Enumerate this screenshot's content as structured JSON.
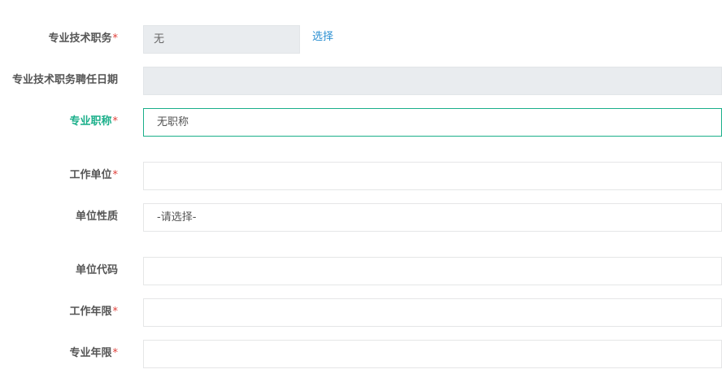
{
  "form": {
    "fields": [
      {
        "label": "专业技术职务",
        "required": true,
        "value": "无",
        "action": "选择"
      },
      {
        "label": "专业技术职务聘任日期",
        "required": false,
        "value": ""
      },
      {
        "label": "专业职称",
        "required": true,
        "value": "无职称"
      },
      {
        "label": "工作单位",
        "required": true,
        "value": ""
      },
      {
        "label": "单位性质",
        "required": false,
        "value": "-请选择-"
      },
      {
        "label": "单位代码",
        "required": false,
        "value": ""
      },
      {
        "label": "工作年限",
        "required": true,
        "value": ""
      },
      {
        "label": "专业年限",
        "required": true,
        "value": ""
      }
    ],
    "required_mark": "*"
  },
  "colors": {
    "active_label": "#1aaf8a",
    "required": "#e0403a",
    "link": "#2a8fd1",
    "readonly_bg": "#e9ecef"
  }
}
